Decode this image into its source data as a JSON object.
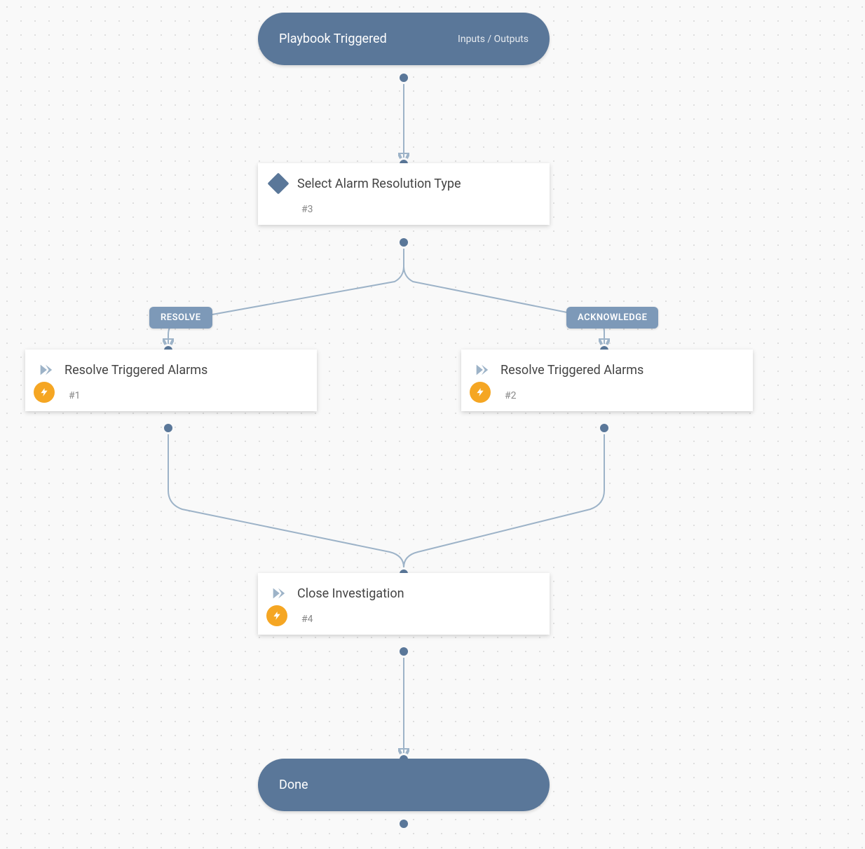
{
  "start": {
    "title": "Playbook Triggered",
    "sub": "Inputs / Outputs"
  },
  "decision": {
    "title": "Select Alarm Resolution Type",
    "id": "#3"
  },
  "branches": {
    "left": "RESOLVE",
    "right": "ACKNOWLEDGE"
  },
  "left_action": {
    "title": "Resolve Triggered Alarms",
    "id": "#1"
  },
  "right_action": {
    "title": "Resolve Triggered Alarms",
    "id": "#2"
  },
  "close_action": {
    "title": "Close Investigation",
    "id": "#4"
  },
  "end": {
    "title": "Done"
  }
}
